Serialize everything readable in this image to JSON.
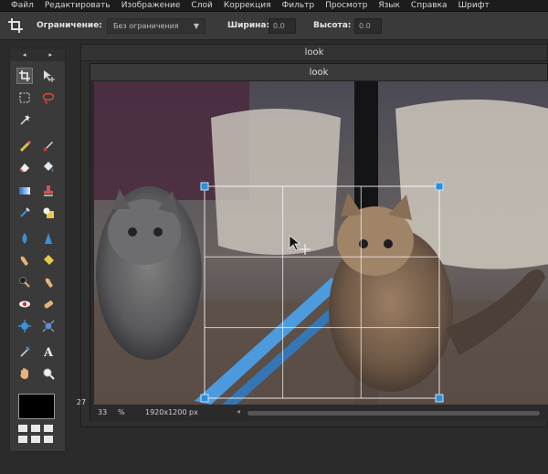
{
  "menu": [
    "Файл",
    "Редактировать",
    "Изображение",
    "Слой",
    "Коррекция",
    "Фильтр",
    "Просмотр",
    "Язык",
    "Справка",
    "Шрифт"
  ],
  "options": {
    "constraint_label": "Ограничение:",
    "constraint_value": "Без ограничения",
    "width_label": "Ширина:",
    "width_value": "0.0",
    "height_label": "Высота:",
    "height_value": "0.0"
  },
  "toolbox": {
    "nav_left": "◂",
    "nav_right": "▸",
    "foreground_color": "#000000"
  },
  "documents": {
    "back_title": "look",
    "front_title": "look",
    "back_side_number": "27"
  },
  "status": {
    "zoom": "33",
    "zoom_unit": "%",
    "dimensions": "1920x1200 px",
    "scroll_arrow": "◂"
  },
  "colors": {
    "accent": "#2e8fd6",
    "panel": "#3a3a3a",
    "background": "#2b2b2b"
  }
}
